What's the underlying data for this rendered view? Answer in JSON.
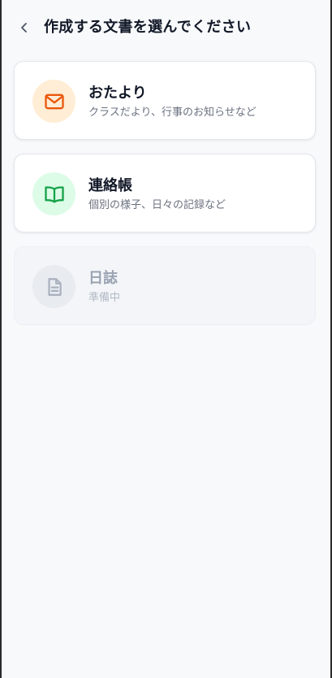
{
  "header": {
    "title": "作成する文書を選んでください",
    "back_icon": "chevron-left-icon"
  },
  "documents": [
    {
      "title": "おたより",
      "description": "クラスだより、行事のお知らせなど",
      "icon": "mail-icon",
      "icon_color": "#ea580c",
      "icon_bg": "#ffedd5",
      "enabled": true
    },
    {
      "title": "連絡帳",
      "description": "個別の様子、日々の記録など",
      "icon": "book-open-icon",
      "icon_color": "#16a34a",
      "icon_bg": "#dcfce7",
      "enabled": true
    },
    {
      "title": "日誌",
      "description": "準備中",
      "icon": "document-icon",
      "icon_color": "#a8afbd",
      "icon_bg": "#e8ebf0",
      "enabled": false
    }
  ]
}
